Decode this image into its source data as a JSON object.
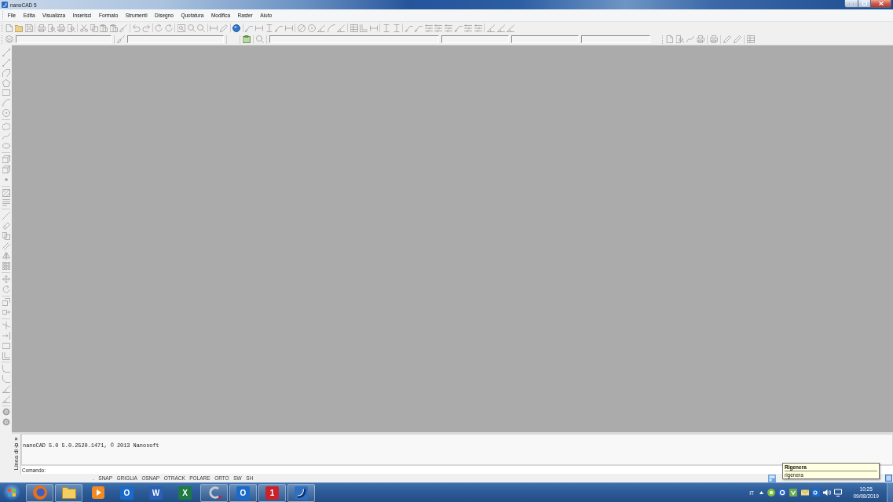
{
  "window": {
    "title": "nanoCAD 5"
  },
  "menu": [
    "File",
    "Edita",
    "Visualizza",
    "Inserisci",
    "Formato",
    "Strumenti",
    "Disegno",
    "Quotatura",
    "Modifica",
    "Raster",
    "Aiuto"
  ],
  "command_line": {
    "close": "×",
    "title": "Linea di",
    "history": [
      "nanoCAD 5.0 5.0.2520.1471, © 2013 Nanosoft"
    ],
    "prompt": "Comando:"
  },
  "status_bar": {
    "lead": ".",
    "toggles": [
      "SNAP",
      "GRIGLIA",
      "OSNAP",
      "OTRACK",
      "POLARE",
      "ORTO",
      "SW",
      "SH"
    ]
  },
  "tooltip": {
    "title": "Rigenera",
    "text": "rigenera"
  },
  "taskbar": {
    "apps": [
      {
        "kind": "browser",
        "running": true
      },
      {
        "kind": "folder",
        "running": true
      },
      {
        "kind": "player",
        "running": false
      },
      {
        "kind": "letter",
        "glyph": "O",
        "color": "#1b6ac9",
        "running": false
      },
      {
        "kind": "letter",
        "glyph": "W",
        "color": "#2b5fb4",
        "running": false
      },
      {
        "kind": "letter",
        "glyph": "X",
        "color": "#1e7a45",
        "running": false
      },
      {
        "kind": "tool",
        "running": true
      },
      {
        "kind": "letter",
        "glyph": "O",
        "color": "#1b6ac9",
        "running": true
      },
      {
        "kind": "letter",
        "glyph": "1",
        "color": "#c8232c",
        "running": true
      },
      {
        "kind": "cad",
        "running": true
      }
    ],
    "language": "IT",
    "time": "10:25",
    "date": "09/08/2019"
  }
}
